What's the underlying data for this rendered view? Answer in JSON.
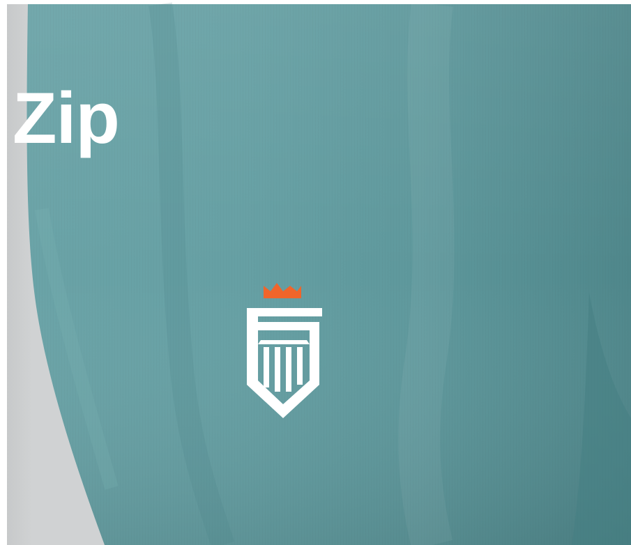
{
  "overlay": {
    "word": "Zip"
  },
  "garment": {
    "color": "#5f9a9e",
    "logo_icon": "crowned-shield-logo-icon",
    "crown_color": "#f0652a",
    "shield_color": "#ffffff"
  }
}
